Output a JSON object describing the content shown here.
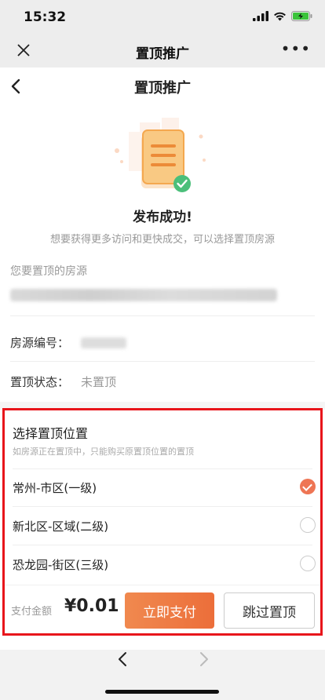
{
  "status": {
    "time": "15:32"
  },
  "wechat": {
    "title": "置顶推广"
  },
  "nav": {
    "title": "置顶推广"
  },
  "success": {
    "title": "发布成功!",
    "subtitle": "想要获得更多访问和更快成交，可以选择置顶房源"
  },
  "listing": {
    "section_label": "您要置顶的房源",
    "id_label": "房源编号：",
    "status_label": "置顶状态：",
    "status_value": "未置顶"
  },
  "placement": {
    "title": "选择置顶位置",
    "subtitle": "如房源正在置顶中，只能购买原置顶位置的置顶",
    "options": [
      {
        "label": "常州-市区(一级)",
        "selected": true
      },
      {
        "label": "新北区-区域(二级)",
        "selected": false
      },
      {
        "label": "恐龙园-街区(三级)",
        "selected": false
      }
    ]
  },
  "payment": {
    "amount_label": "支付金额",
    "amount": "¥0.01",
    "pay_button": "立即支付",
    "skip_button": "跳过置顶"
  },
  "colors": {
    "accent": "#ee7554",
    "highlight_border": "#e8151b"
  }
}
